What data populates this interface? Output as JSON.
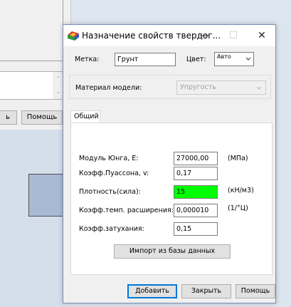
{
  "background": {
    "left_button_partial": "ь",
    "help_button": "Помощь",
    "scroll_up": "⌃",
    "scroll_down": "⌄"
  },
  "dialog": {
    "title": "Назначение свойств твердог...",
    "title_buttons": {
      "minimize": "—",
      "maximize": "☐",
      "close": "✕"
    },
    "label_label": "Метка:",
    "label_value": "Грунт",
    "color_label": "Цвет:",
    "color_value": "Авто",
    "material_label": "Материал модели:",
    "material_value": "Упругость",
    "tab_general": "Общий",
    "properties": [
      {
        "label": "Модуль Юнга, E:",
        "value": "27000,00",
        "unit": "(МПа)",
        "highlight": false
      },
      {
        "label": "Коэфф.Пуассона, v:",
        "value": "0,17",
        "unit": "",
        "highlight": false
      },
      {
        "label": "Плотность(сила):",
        "value": "15",
        "unit": "(кН/м3)",
        "highlight": true
      },
      {
        "label": "Коэфф.темп. расширения:",
        "value": "0,000010",
        "unit": "(1/°Ц)",
        "highlight": false
      },
      {
        "label": "Коэфф.затухания:",
        "value": "0,15",
        "unit": "",
        "highlight": false
      }
    ],
    "import_button": "Импорт из базы данных",
    "add_button": "Добавить",
    "close_button": "Закрыть",
    "help_button": "Помощь",
    "highlight_color": "#00ff00",
    "accent_color": "#0078d7"
  }
}
